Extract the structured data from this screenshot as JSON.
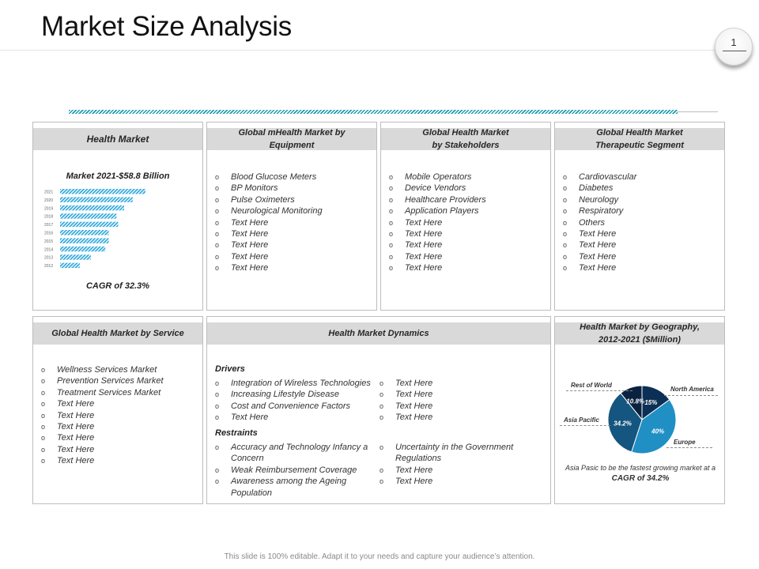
{
  "slide": {
    "title": "Market Size Analysis",
    "page_number": "1",
    "footer": "This slide is 100% editable. Adapt it to your needs and capture your audience’s attention."
  },
  "colors": {
    "hatch": "#1a9bb0",
    "bar_blue": "#2fa8dc",
    "header_gray": "#d9d9d9"
  },
  "health_market": {
    "title": "Health Market",
    "market_label": "Market 2021-$58.8 Billion",
    "cagr": "CAGR of 32.3%"
  },
  "chart_data": {
    "type": "bar",
    "orientation": "horizontal",
    "title": "Market 2021-$58.8 Billion",
    "categories": [
      "2021",
      "2020",
      "2019",
      "2018",
      "2017",
      "2016",
      "2015",
      "2014",
      "2013",
      "2012"
    ],
    "values": [
      100,
      85,
      75,
      66,
      68,
      57,
      57,
      53,
      36,
      23
    ],
    "value_unit": "relative bar length (no axis printed)"
  },
  "mhealth_equipment": {
    "title": "Global mHealth Market by Equipment",
    "items": [
      "Blood Glucose Meters",
      "BP Monitors",
      "Pulse Oximeters",
      "Neurological Monitoring",
      "Text Here",
      "Text Here",
      "Text Here",
      "Text Here",
      "Text Here"
    ]
  },
  "stakeholders": {
    "title": "Global Health Market by Stakeholders",
    "items": [
      "Mobile Operators",
      "Device Vendors",
      "Healthcare Providers",
      "Application Players",
      "Text Here",
      "Text Here",
      "Text Here",
      "Text Here",
      "Text Here"
    ]
  },
  "therapeutic": {
    "title": "Global Health Market Therapeutic Segment",
    "items": [
      "Cardiovascular",
      "Diabetes",
      "Neurology",
      "Respiratory",
      "Others",
      "Text Here",
      "Text Here",
      "Text Here",
      "Text Here"
    ]
  },
  "service": {
    "title": "Global Health Market by Service",
    "items": [
      "Wellness Services Market",
      "Prevention Services Market",
      "Treatment Services Market",
      "Text Here",
      "Text Here",
      "Text Here",
      "Text Here",
      "Text Here",
      "Text Here"
    ]
  },
  "dynamics": {
    "title": "Health Market Dynamics",
    "drivers_heading": "Drivers",
    "drivers_left": [
      "Integration of Wireless Technologies",
      "Increasing Lifestyle Disease",
      "Cost and Convenience Factors",
      "Text Here"
    ],
    "drivers_right": [
      "Text Here",
      "Text Here",
      "Text Here",
      "Text Here"
    ],
    "restraints_heading": "Restraints",
    "restraints_left": [
      "Accuracy and Technology Infancy a Concern",
      "Weak Reimbursement Coverage",
      "Awareness among the Ageing Population"
    ],
    "restraints_right": [
      "Uncertainty in the Government Regulations",
      "Text Here",
      "Text Here"
    ]
  },
  "geography": {
    "title": "Health Market by Geography, 2012-2021 ($Million)",
    "labels": {
      "rest_of_world": "Rest of World",
      "north_america": "North America",
      "asia_pacific": "Asia Pacific",
      "europe": "Europe"
    },
    "slices": [
      {
        "name": "North America",
        "label": "15%",
        "value": 15,
        "color": "#0c2f55"
      },
      {
        "name": "Europe",
        "label": "40%",
        "value": 40,
        "color": "#1f8fc4"
      },
      {
        "name": "Asia Pacific",
        "label": "34.2%",
        "value": 34.2,
        "color": "#14567f"
      },
      {
        "name": "Rest of World",
        "label": "10.8%",
        "value": 10.8,
        "color": "#0a2240"
      }
    ],
    "note_prefix": "Asia Pasic to be the fastest growing market at a",
    "note_emphasis": "CAGR of 34.2%"
  }
}
